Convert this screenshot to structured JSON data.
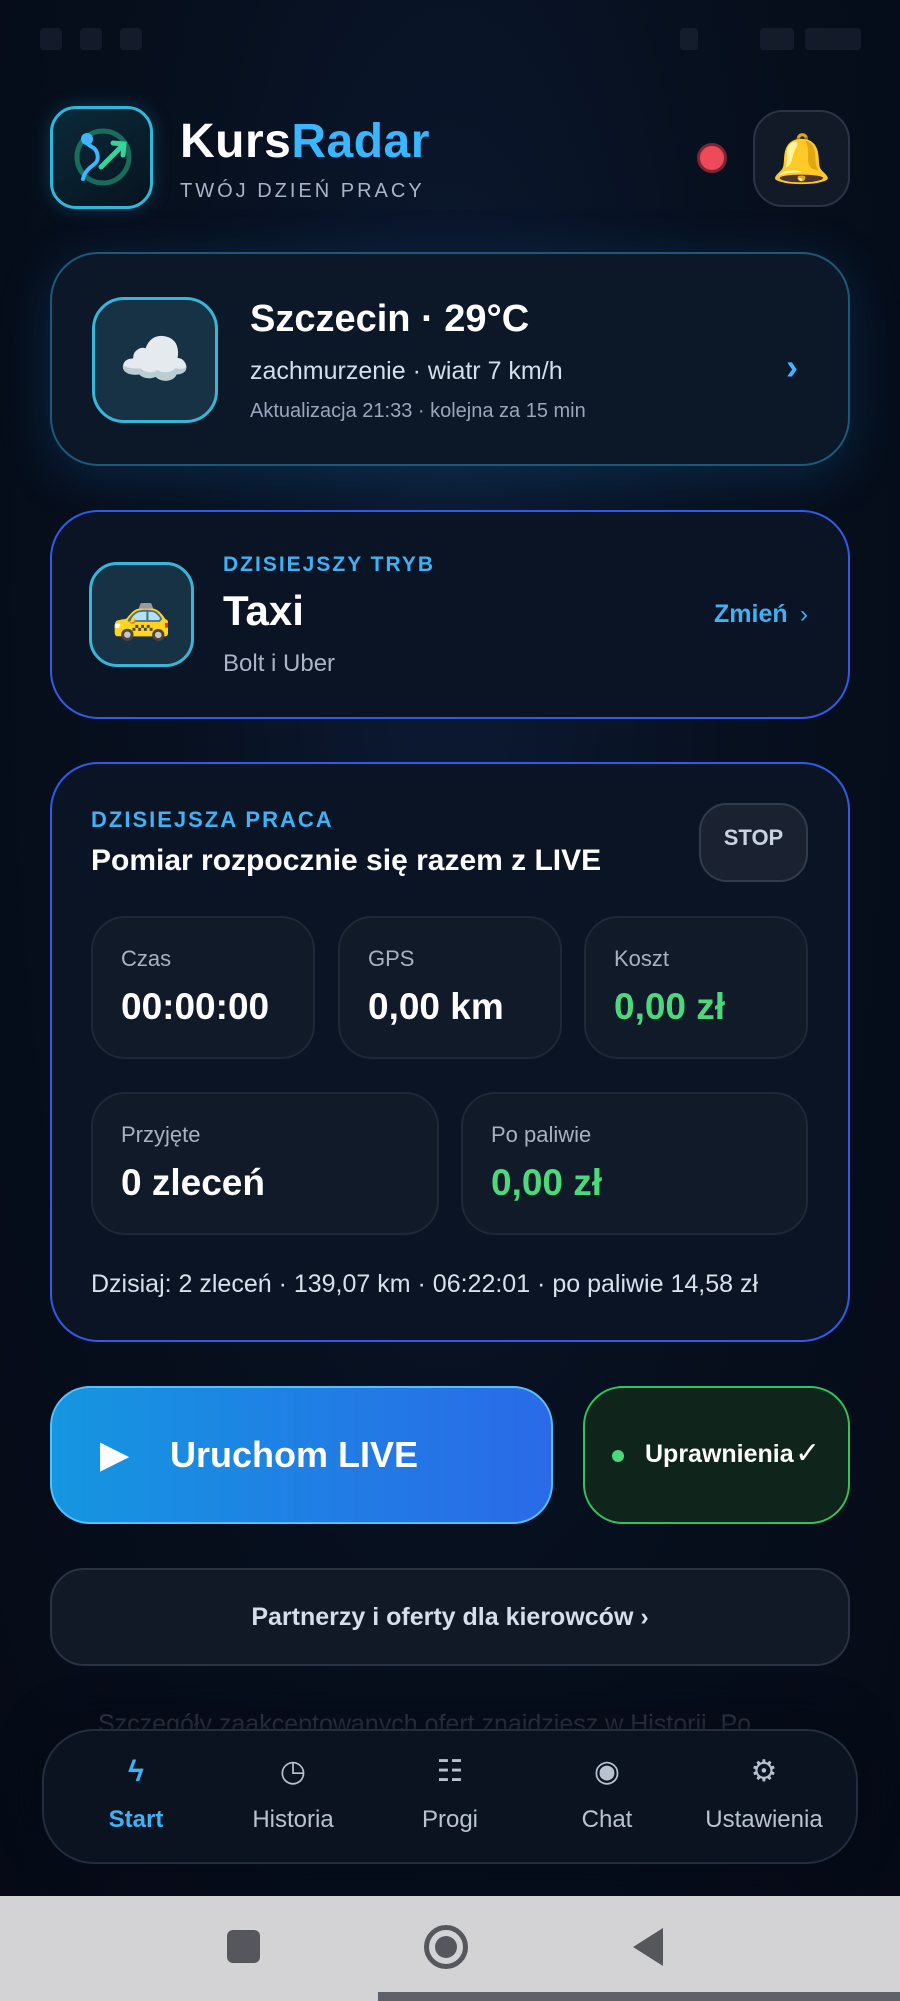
{
  "app": {
    "name_part1": "Kurs",
    "name_part2": "Radar",
    "subtitle": "TWÓJ DZIEŃ PRACY"
  },
  "weather": {
    "city_temp": "Szczecin · 29°C",
    "description": "zachmurzenie · wiatr 7 km/h",
    "updated": "Aktualizacja 21:33 · kolejna za 15 min",
    "icon": "cloud-icon"
  },
  "mode": {
    "label": "DZISIEJSZY TRYB",
    "title": "Taxi",
    "subtitle": "Bolt i Uber",
    "change_label": "Zmień",
    "icon": "taxi-icon"
  },
  "work": {
    "label": "DZISIEJSZA PRACA",
    "title": "Pomiar rozpocznie się razem z LIVE",
    "stop_label": "STOP",
    "stats": {
      "time": {
        "label": "Czas",
        "value": "00:00:00"
      },
      "gps": {
        "label": "GPS",
        "value": "0,00 km"
      },
      "cost": {
        "label": "Koszt",
        "value": "0,00 zł"
      },
      "accepted": {
        "label": "Przyjęte",
        "value": "0 zleceń"
      },
      "after_fuel": {
        "label": "Po paliwie",
        "value": "0,00 zł"
      }
    },
    "today_summary": "Dzisiaj: 2 zleceń · 139,07 km · 06:22:01 · po paliwie 14,58 zł"
  },
  "actions": {
    "live_label": "Uruchom LIVE",
    "permissions_label": "Uprawnienia",
    "partners_label": "Partnerzy i oferty dla kierowców ›"
  },
  "footer_note": "Szczegóły zaakceptowanych ofert znajdziesz w Historii. Po",
  "nav": [
    {
      "label": "Start",
      "icon": "lightning-icon",
      "active": true
    },
    {
      "label": "Historia",
      "icon": "clock-icon",
      "active": false
    },
    {
      "label": "Progi",
      "icon": "list-icon",
      "active": false
    },
    {
      "label": "Chat",
      "icon": "chat-icon",
      "active": false
    },
    {
      "label": "Ustawienia",
      "icon": "gear-icon",
      "active": false
    }
  ],
  "colors": {
    "accent": "#3fb2f5",
    "positive": "#4cd97b",
    "alert": "#ef4a5a"
  }
}
